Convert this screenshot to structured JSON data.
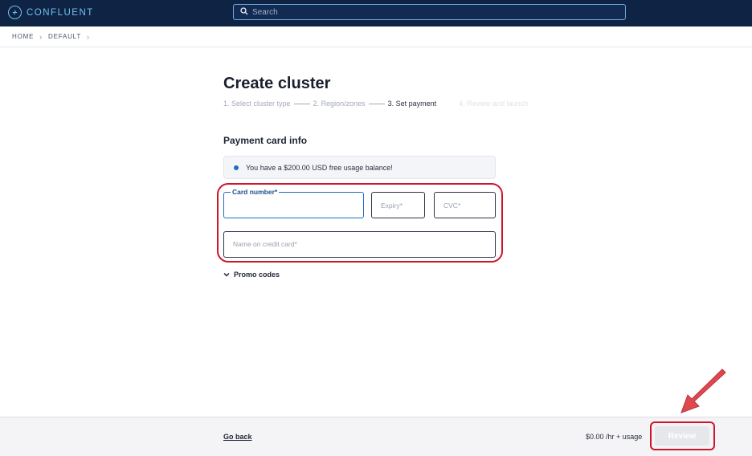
{
  "header": {
    "brand": "CONFLUENT",
    "search_placeholder": "Search"
  },
  "breadcrumb": {
    "items": [
      "HOME",
      "DEFAULT"
    ]
  },
  "page": {
    "title": "Create cluster",
    "steps": [
      {
        "label": "1. Select cluster type",
        "state": "done"
      },
      {
        "label": "2. Region/zones",
        "state": "done"
      },
      {
        "label": "3. Set payment",
        "state": "active"
      },
      {
        "label": "4. Review and launch",
        "state": "pending"
      }
    ]
  },
  "payment": {
    "section_title": "Payment card info",
    "info_message": "You have a $200.00 USD free usage balance!",
    "card_number_label": "Card number*",
    "card_number_value": "",
    "expiry_placeholder": "Expiry*",
    "cvc_placeholder": "CVC*",
    "name_placeholder": "Name on credit card*",
    "promo_label": "Promo codes"
  },
  "footer": {
    "go_back": "Go back",
    "price": "$0.00 /hr + usage",
    "review": "Review"
  },
  "colors": {
    "topbar": "#0f2344",
    "accent": "#1e6fbf",
    "highlight": "#d0142c",
    "annotation_arrow": "#e0484f"
  },
  "icons": [
    "confluent-logo-icon",
    "search-icon",
    "chevron-right-icon",
    "info-dot-icon",
    "chevron-down-icon",
    "annotation-arrow-icon"
  ]
}
